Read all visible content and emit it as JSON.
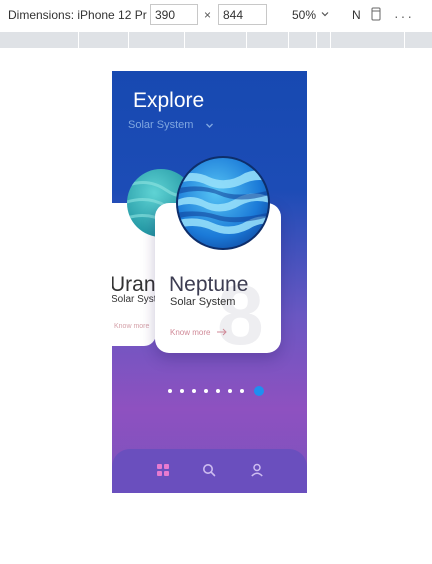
{
  "devtools": {
    "dimensions_label": "Dimensions: iPhone 12 Pr",
    "width_value": "390",
    "height_value": "844",
    "times_symbol": "×",
    "zoom": "50%",
    "n_label": "N",
    "more_glyph": "···"
  },
  "app": {
    "title": "Explore",
    "subtitle": "Solar System",
    "back_card": {
      "title": "Uranus",
      "subtitle": "Solar System",
      "link": "Know more"
    },
    "card": {
      "title": "Neptune",
      "subtitle": "Solar System",
      "link": "Know more",
      "number": "8"
    },
    "dots": {
      "count": 8,
      "active_index": 7
    },
    "nav": {
      "items": [
        "home",
        "search",
        "profile"
      ],
      "active": "home"
    }
  },
  "colors": {
    "gradient_top": "#1749b1",
    "gradient_bottom": "#8e51c0",
    "dot_active": "#1f8ff0",
    "nav_bg": "#6a4fbe",
    "link": "#d08a98",
    "home_icon": "#e77bd0"
  }
}
